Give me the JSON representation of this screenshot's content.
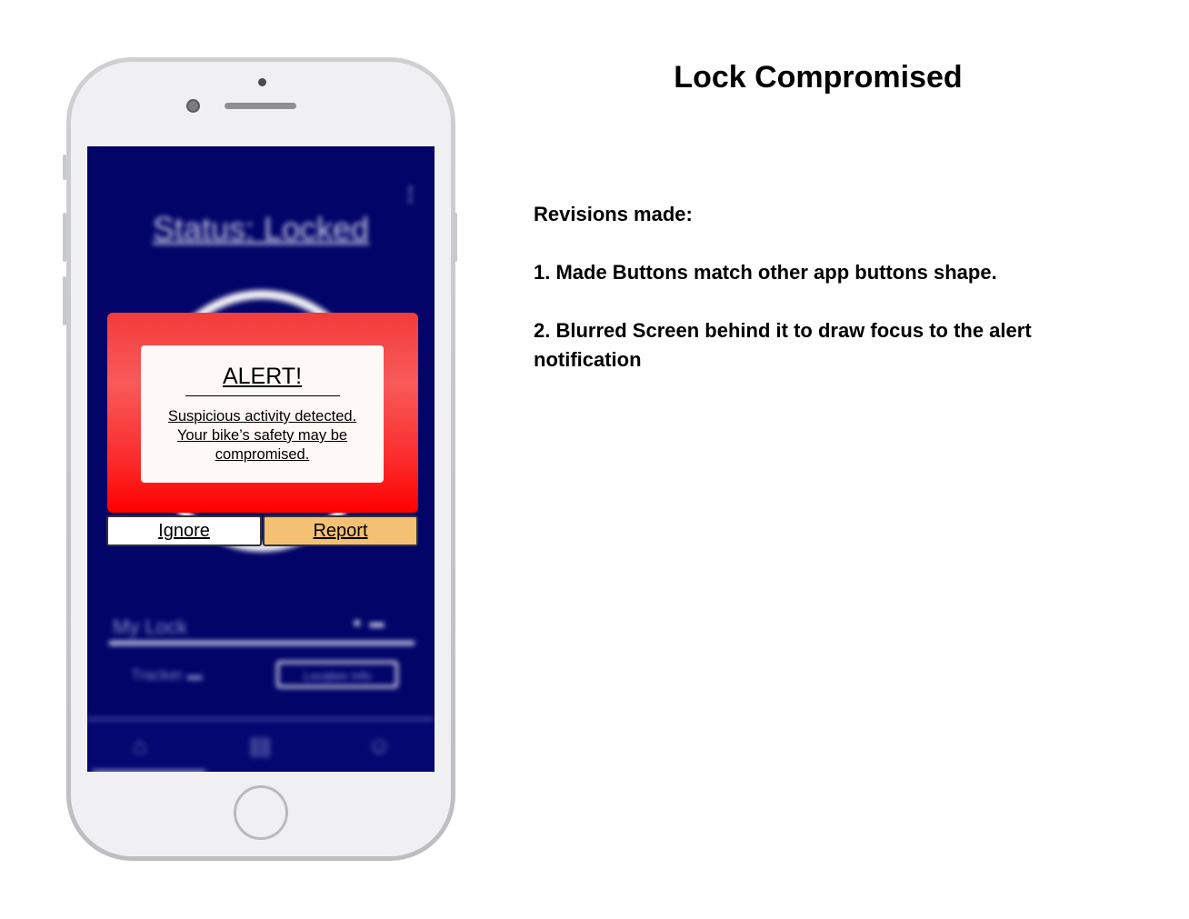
{
  "page": {
    "title": "Lock Compromised",
    "notes": [
      "Revisions made:",
      "1. Made Buttons match other app buttons shape.",
      "2. Blurred Screen behind it to draw focus to the alert notification"
    ]
  },
  "phone_screen": {
    "background_status": "Status: Locked",
    "my_lock_label": "My Lock",
    "tracker_label": "Tracker",
    "location_button": "Location Info",
    "alert": {
      "title": "ALERT!",
      "message": "Suspicious activity detected. Your bike’s safety may be compromised.",
      "ignore_label": "Ignore",
      "report_label": "Report"
    },
    "nav_icons": [
      "home-icon",
      "map-icon",
      "profile-icon"
    ]
  },
  "colors": {
    "screen_bg": "#020468",
    "alert_red": "#ff0000",
    "report_button": "#f4c174",
    "ignore_button": "#ffffff"
  }
}
